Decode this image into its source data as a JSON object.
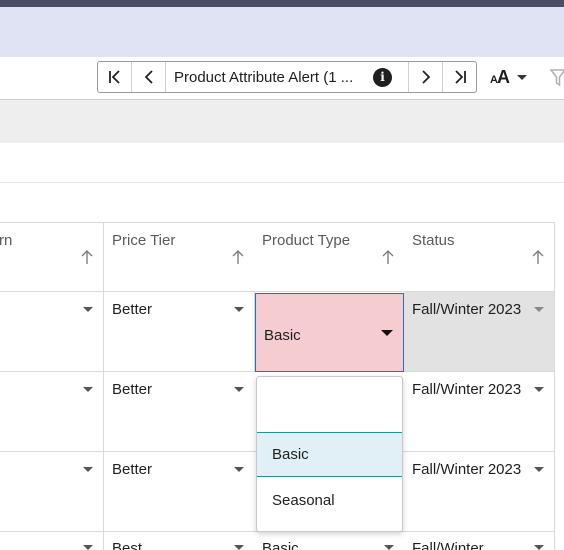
{
  "pager": {
    "title": "Product Attribute Alert (1 ...",
    "info_glyph": "i"
  },
  "font_control": {
    "label_small": "A",
    "label_big": "A"
  },
  "columns": [
    {
      "label": "rn"
    },
    {
      "label": "Price Tier"
    },
    {
      "label": "Product Type"
    },
    {
      "label": "Status"
    }
  ],
  "rows": [
    {
      "price_tier": "Better",
      "product_type": "Basic",
      "status": "Fall/Winter 2023"
    },
    {
      "price_tier": "Better",
      "product_type": "",
      "status": "Fall/Winter 2023"
    },
    {
      "price_tier": "Better",
      "product_type": "",
      "status": "Fall/Winter 2023"
    },
    {
      "price_tier": "Best",
      "product_type": "Basic",
      "status": "Fall/Winter"
    }
  ],
  "dropdown": {
    "search_value": "",
    "options": [
      "Basic",
      "Seasonal"
    ],
    "selected": "Basic"
  },
  "colors": {
    "active_cell_bg": "#f5cdd1",
    "active_cell_border": "#2a6fb5",
    "selected_option_bg": "#e1f0f7",
    "header_band": "#dfe3f3"
  }
}
